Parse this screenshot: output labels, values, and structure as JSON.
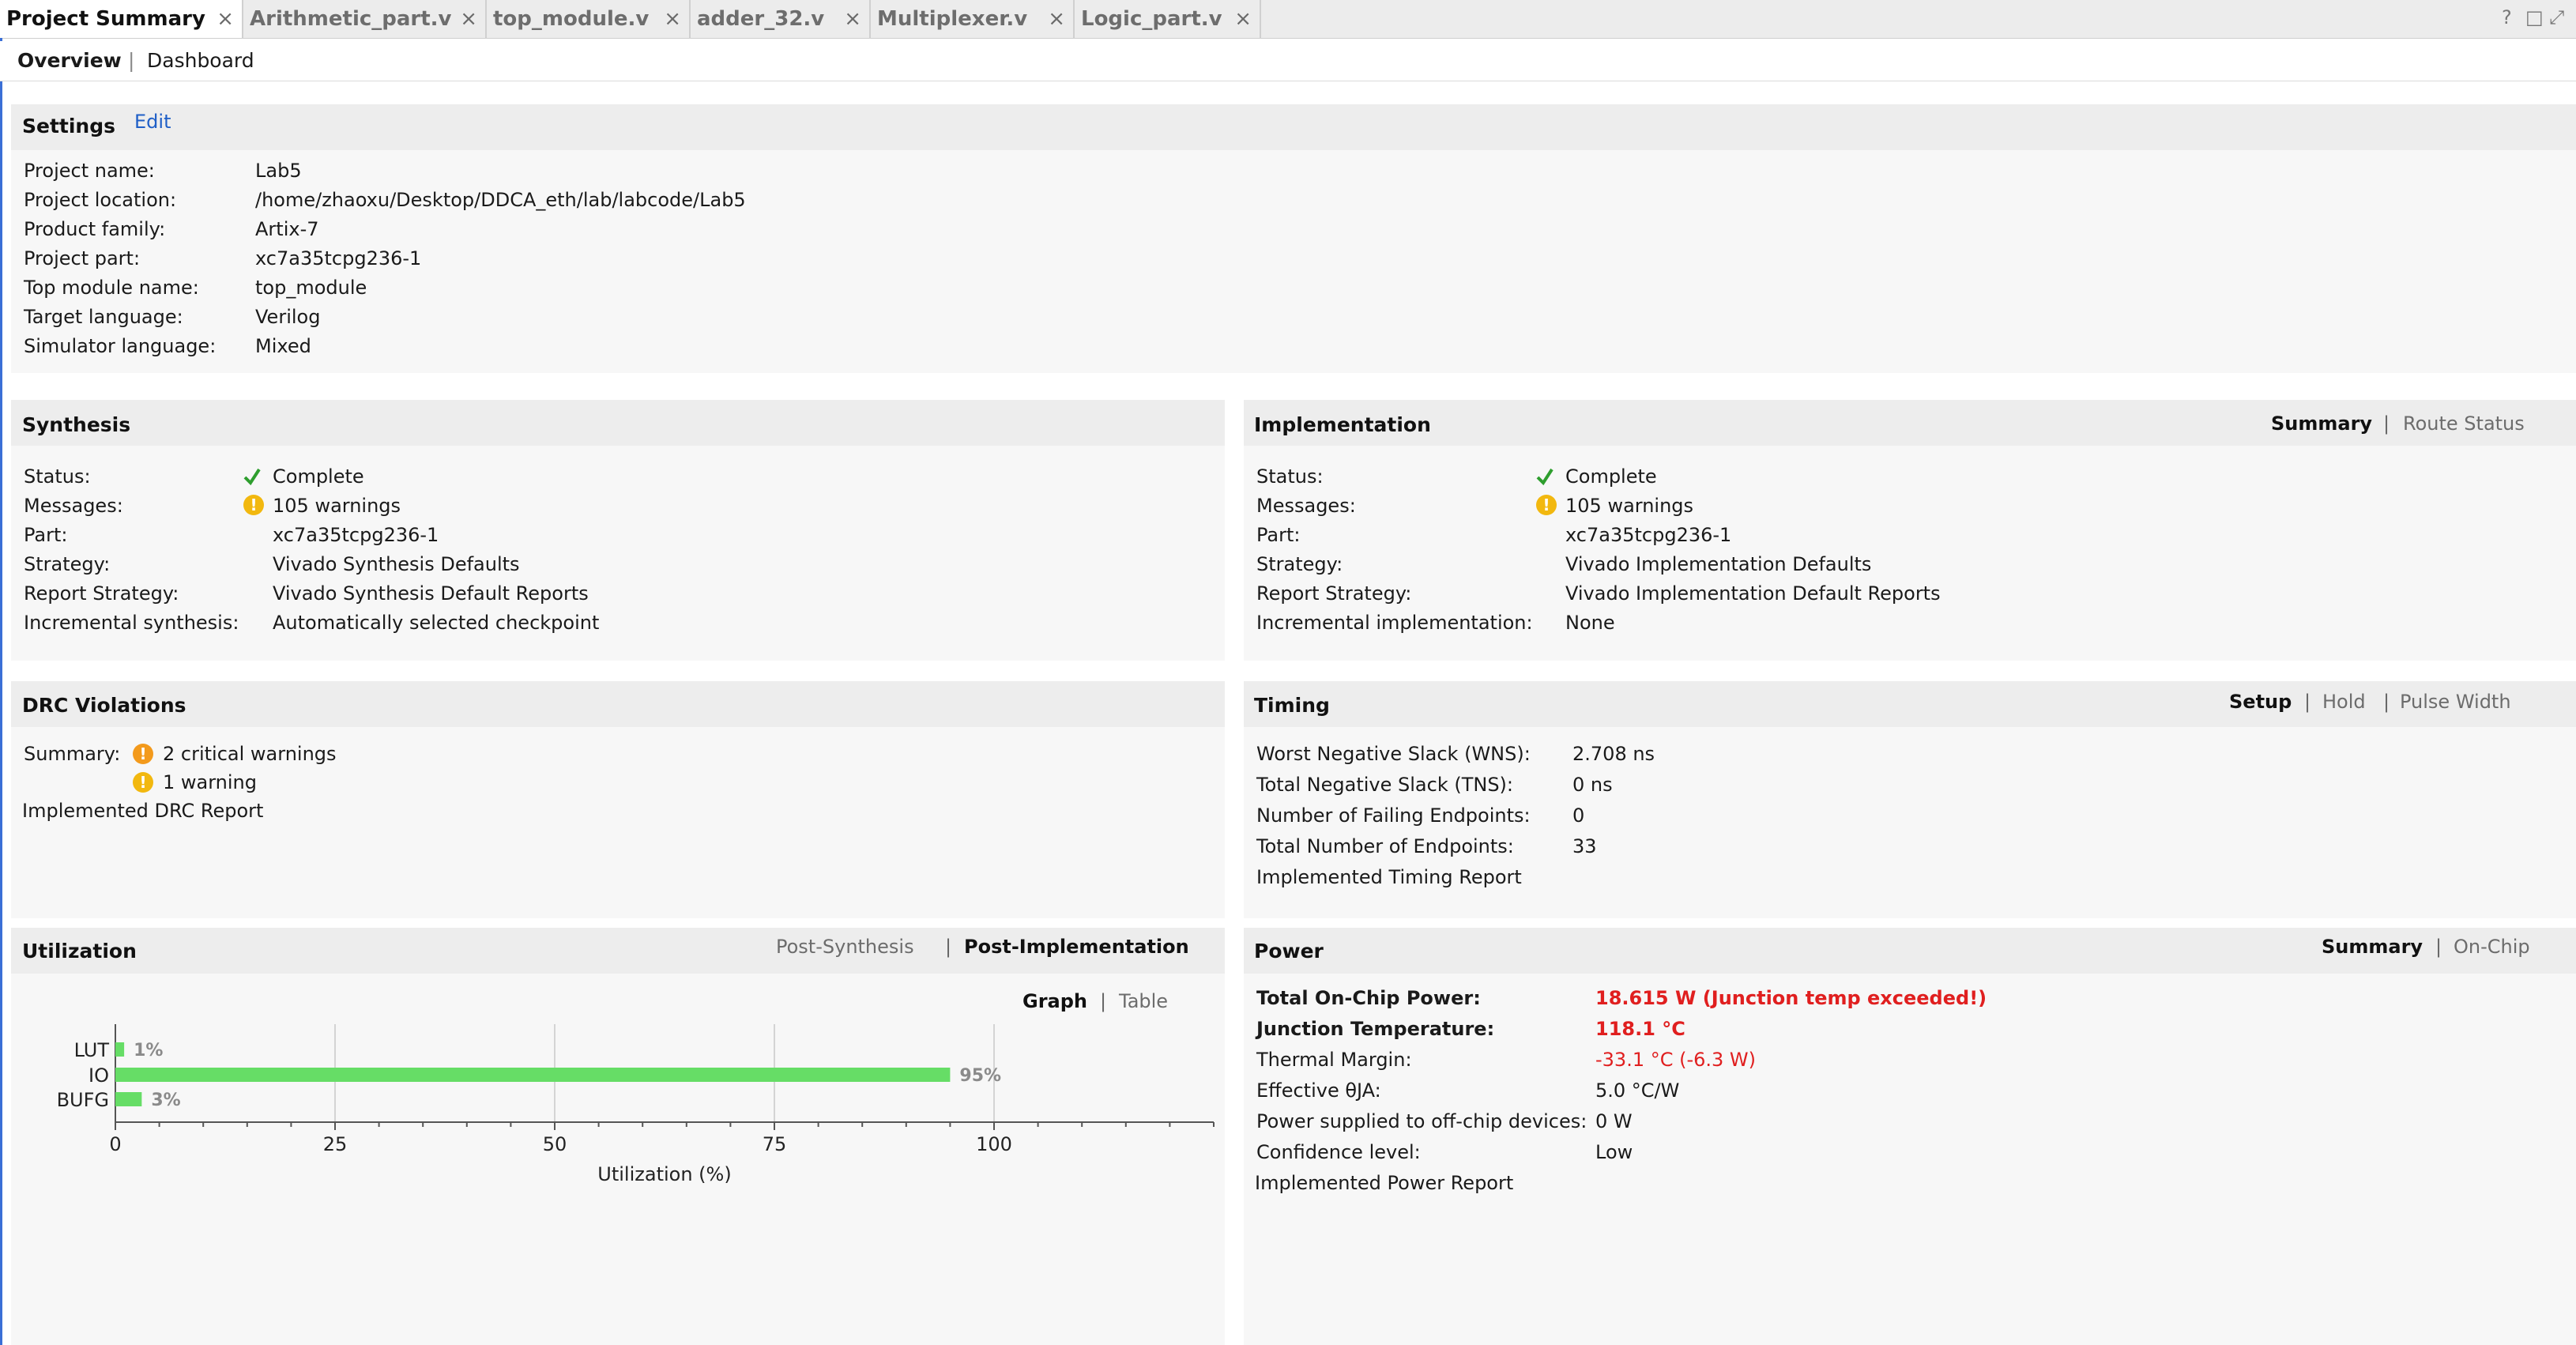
{
  "tabs": [
    {
      "label": "Project Summary",
      "active": true
    },
    {
      "label": "Arithmetic_part.v",
      "active": false
    },
    {
      "label": "top_module.v",
      "active": false
    },
    {
      "label": "adder_32.v",
      "active": false
    },
    {
      "label": "Multiplexer.v",
      "active": false
    },
    {
      "label": "Logic_part.v",
      "active": false
    }
  ],
  "tab_close_glyph": "×",
  "corner_icons": {
    "help": "?",
    "restore": "□",
    "maximize": "⤢"
  },
  "subnav": {
    "overview": "Overview",
    "separator": "|",
    "dashboard": "Dashboard"
  },
  "settings": {
    "title": "Settings",
    "edit": "Edit",
    "rows": [
      {
        "label": "Project name:",
        "value": "Lab5",
        "link": false
      },
      {
        "label": "Project location:",
        "value": "/home/zhaoxu/Desktop/DDCA_eth/lab/labcode/Lab5",
        "link": false
      },
      {
        "label": "Product family:",
        "value": "Artix-7",
        "link": false
      },
      {
        "label": "Project part:",
        "value": "xc7a35tcpg236-1",
        "link": true
      },
      {
        "label": "Top module name:",
        "value": "top_module",
        "link": true
      },
      {
        "label": "Target language:",
        "value": "Verilog",
        "link": true
      },
      {
        "label": "Simulator language:",
        "value": "Mixed",
        "link": true
      }
    ]
  },
  "synthesis": {
    "title": "Synthesis",
    "rows": [
      {
        "label": "Status:",
        "value": "Complete"
      },
      {
        "label": "Messages:",
        "value": "105 warnings"
      },
      {
        "label": "Part:",
        "value": "xc7a35tcpg236-1"
      },
      {
        "label": "Strategy:",
        "value": "Vivado Synthesis Defaults"
      },
      {
        "label": "Report Strategy:",
        "value": "Vivado Synthesis Default Reports"
      },
      {
        "label": "Incremental synthesis:",
        "value": "Automatically selected checkpoint"
      }
    ]
  },
  "implementation": {
    "title": "Implementation",
    "tab_summary": "Summary",
    "tab_route": "Route Status",
    "rows": [
      {
        "label": "Status:",
        "value": "Complete"
      },
      {
        "label": "Messages:",
        "value": "105 warnings"
      },
      {
        "label": "Part:",
        "value": "xc7a35tcpg236-1"
      },
      {
        "label": "Strategy:",
        "value": "Vivado Implementation Defaults"
      },
      {
        "label": "Report Strategy:",
        "value": "Vivado Implementation Default Reports"
      },
      {
        "label": "Incremental implementation:",
        "value": "None"
      }
    ]
  },
  "drc": {
    "title": "DRC Violations",
    "summary_label": "Summary:",
    "critical": "2 critical warnings",
    "warning": "1 warning",
    "report": "Implemented DRC Report"
  },
  "timing": {
    "title": "Timing",
    "tab_setup": "Setup",
    "tab_hold": "Hold",
    "tab_pulse": "Pulse Width",
    "rows": [
      {
        "label": "Worst Negative Slack (WNS):",
        "value": "2.708 ns"
      },
      {
        "label": "Total Negative Slack (TNS):",
        "value": "0 ns"
      },
      {
        "label": "Number of Failing Endpoints:",
        "value": "0"
      },
      {
        "label": "Total Number of Endpoints:",
        "value": "33"
      }
    ],
    "report": "Implemented Timing Report"
  },
  "utilization": {
    "title": "Utilization",
    "tab_post_synth": "Post-Synthesis",
    "tab_post_impl": "Post-Implementation",
    "tab_graph": "Graph",
    "tab_table": "Table"
  },
  "chart_data": {
    "type": "bar",
    "orientation": "horizontal",
    "categories": [
      "LUT",
      "IO",
      "BUFG"
    ],
    "values": [
      1,
      95,
      3
    ],
    "value_labels": [
      "1%",
      "95%",
      "3%"
    ],
    "xlabel": "Utilization (%)",
    "ylabel": "",
    "xlim": [
      0,
      125
    ],
    "xticks": [
      0,
      25,
      50,
      75,
      100
    ],
    "bar_color": "#66dd66",
    "grid": true
  },
  "power": {
    "title": "Power",
    "tab_summary": "Summary",
    "tab_onchip": "On-Chip",
    "rows": [
      {
        "label": "Total On-Chip Power:",
        "value": "18.615 W (Junction temp exceeded!)",
        "style": "redbold",
        "labelbold": true
      },
      {
        "label": "Junction Temperature:",
        "value": "118.1 °C",
        "style": "redbold",
        "labelbold": true
      },
      {
        "label": "Thermal Margin:",
        "value": "-33.1 °C (-6.3 W)",
        "style": "red",
        "labelbold": false
      },
      {
        "label": "Effective θJA:",
        "value": "5.0 °C/W",
        "style": "plain",
        "labelbold": false
      },
      {
        "label": "Power supplied to off-chip devices:",
        "value": "0 W",
        "style": "plain",
        "labelbold": false
      },
      {
        "label": "Confidence level:",
        "value": "Low",
        "style": "link",
        "labelbold": false
      }
    ],
    "report": "Implemented Power Report"
  },
  "colors": {
    "link": "#1f5fc7",
    "warning": "#f2b80f",
    "critical": "#f39a1c",
    "check": "#2e9e2e",
    "error": "#e01f1f",
    "bar": "#66dd66"
  }
}
